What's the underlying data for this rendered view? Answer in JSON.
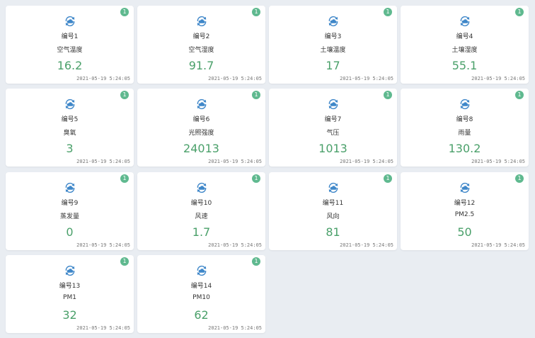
{
  "colors": {
    "background": "#e9edf2",
    "card": "#ffffff",
    "badge": "#5fb98f",
    "value": "#4aa06a",
    "icon": "#3f87c9"
  },
  "icon_name": "cloud-sync-icon",
  "sensors": [
    {
      "code": "编号1",
      "name": "空气温度",
      "value": "16.2",
      "badge": "1",
      "timestamp": "2021-05-19 5:24:05"
    },
    {
      "code": "编号2",
      "name": "空气湿度",
      "value": "91.7",
      "badge": "1",
      "timestamp": "2021-05-19 5:24:05"
    },
    {
      "code": "编号3",
      "name": "土壤温度",
      "value": "17",
      "badge": "1",
      "timestamp": "2021-05-19 5:24:05"
    },
    {
      "code": "编号4",
      "name": "土壤湿度",
      "value": "55.1",
      "badge": "1",
      "timestamp": "2021-05-19 5:24:05"
    },
    {
      "code": "编号5",
      "name": "臭氧",
      "value": "3",
      "badge": "1",
      "timestamp": "2021-05-19 5:24:05"
    },
    {
      "code": "编号6",
      "name": "光照强度",
      "value": "24013",
      "badge": "1",
      "timestamp": "2021-05-19 5:24:05"
    },
    {
      "code": "编号7",
      "name": "气压",
      "value": "1013",
      "badge": "1",
      "timestamp": "2021-05-19 5:24:05"
    },
    {
      "code": "编号8",
      "name": "雨量",
      "value": "130.2",
      "badge": "1",
      "timestamp": "2021-05-19 5:24:05"
    },
    {
      "code": "编号9",
      "name": "蒸发量",
      "value": "0",
      "badge": "1",
      "timestamp": "2021-05-19 5:24:05"
    },
    {
      "code": "编号10",
      "name": "风速",
      "value": "1.7",
      "badge": "1",
      "timestamp": "2021-05-19 5:24:05"
    },
    {
      "code": "编号11",
      "name": "风向",
      "value": "81",
      "badge": "1",
      "timestamp": "2021-05-19 5:24:05"
    },
    {
      "code": "编号12",
      "name": "PM2.5",
      "value": "50",
      "badge": "1",
      "timestamp": "2021-05-19 5:24:05"
    },
    {
      "code": "编号13",
      "name": "PM1",
      "value": "32",
      "badge": "1",
      "timestamp": "2021-05-19 5:24:05"
    },
    {
      "code": "编号14",
      "name": "PM10",
      "value": "62",
      "badge": "1",
      "timestamp": "2021-05-19 5:24:05"
    }
  ]
}
